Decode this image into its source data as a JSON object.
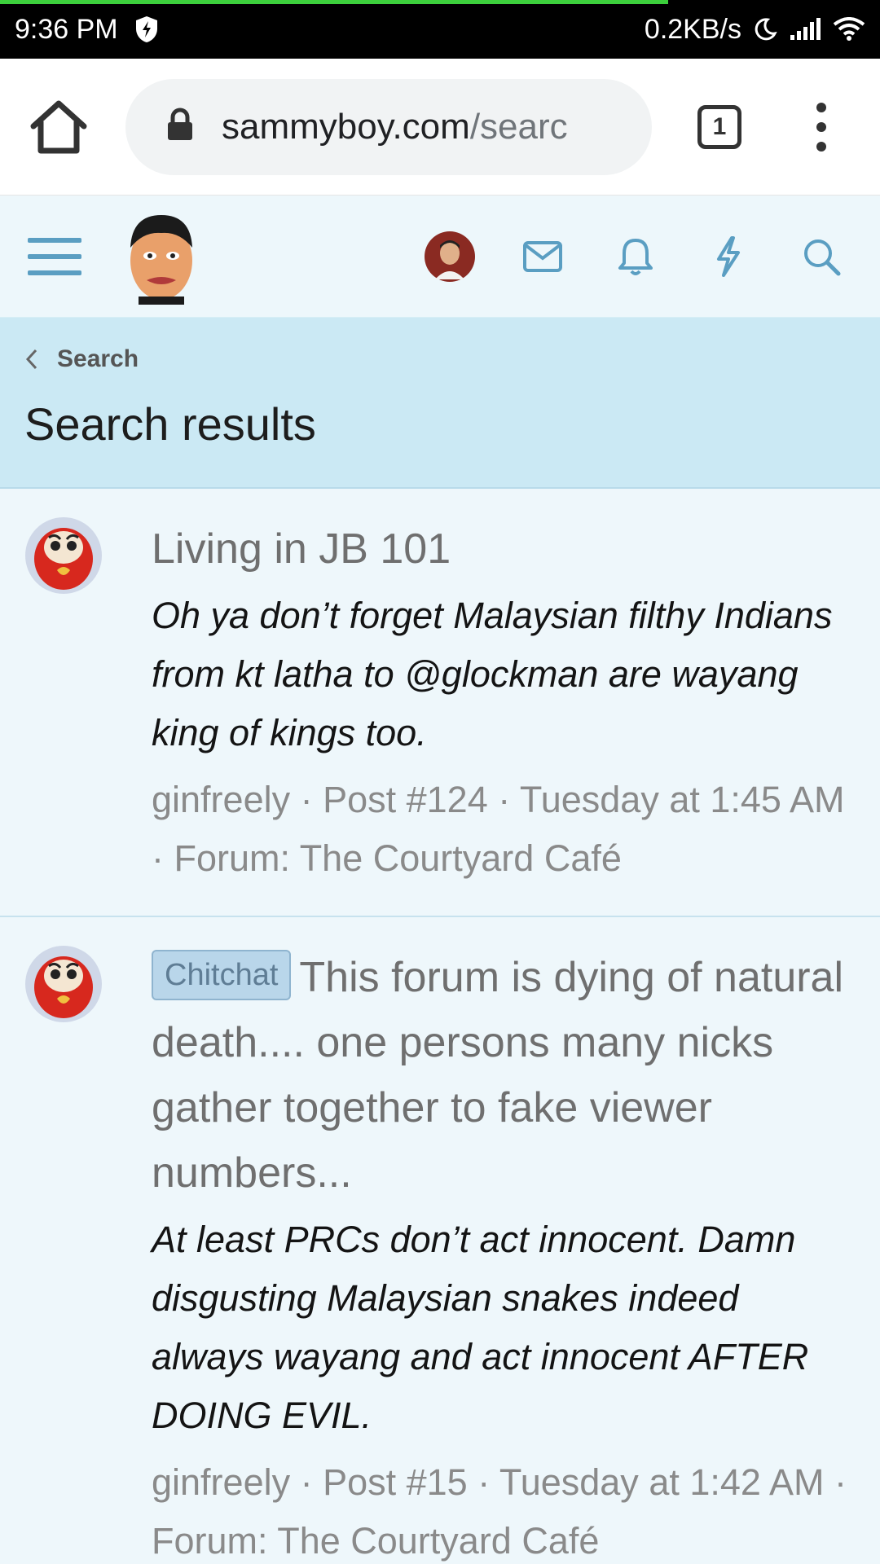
{
  "status_bar": {
    "time": "9:36 PM",
    "speed": "0.2KB/s"
  },
  "browser": {
    "url_host": "sammyboy.com",
    "url_path": "/searc",
    "tab_count": "1"
  },
  "breadcrumb": {
    "label": "Search"
  },
  "page_title": "Search results",
  "results": [
    {
      "title": "Living in JB 101",
      "snippet": "Oh ya don’t forget Malaysian filthy Indians from kt latha to @glockman are wayang king of kings too.",
      "meta": "ginfreely · Post #124 · Tuesday at 1:45 AM · Forum: The Courtyard Café"
    },
    {
      "prefix": "Chitchat",
      "title": "This forum is dying of natural death.... one persons many nicks gather together to fake viewer numbers...",
      "snippet": "At least PRCs don’t act innocent. Damn disgusting Malaysian snakes indeed always wayang and act innocent AFTER DOING EVIL.",
      "meta": "ginfreely · Post #15 · Tuesday at 1:42 AM · Forum: The Courtyard Café"
    }
  ],
  "colors": {
    "accent": "#5a9ec2",
    "title_region": "#cbe9f4",
    "background": "#eef7fb",
    "prefix_badge": "#b9d6ea"
  }
}
